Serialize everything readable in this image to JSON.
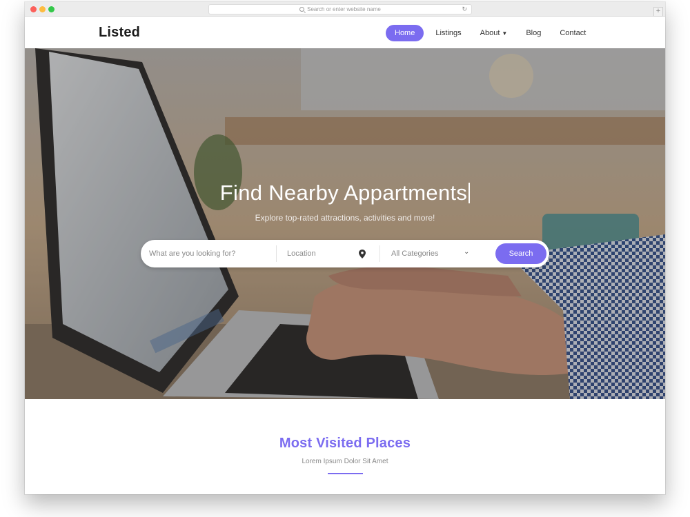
{
  "browser": {
    "address_placeholder": "Search or enter website name",
    "new_tab_symbol": "+"
  },
  "site": {
    "brand": "Listed",
    "nav": [
      {
        "label": "Home",
        "active": true
      },
      {
        "label": "Listings",
        "active": false
      },
      {
        "label": "About",
        "active": false,
        "dropdown": true
      },
      {
        "label": "Blog",
        "active": false
      },
      {
        "label": "Contact",
        "active": false
      }
    ]
  },
  "hero": {
    "title": "Find Nearby Appartments",
    "subtitle": "Explore top-rated attractions, activities and more!",
    "search": {
      "what_placeholder": "What are you looking for?",
      "location_placeholder": "Location",
      "category_value": "All Categories",
      "button_label": "Search"
    }
  },
  "section": {
    "title": "Most Visited Places",
    "subtitle": "Lorem Ipsum Dolor Sit Amet"
  },
  "colors": {
    "accent": "#7b6cf0",
    "brand_text": "#1b1b1b"
  },
  "icons": [
    "search-icon",
    "reload-icon",
    "location-pin-icon",
    "chevron-down-icon"
  ]
}
